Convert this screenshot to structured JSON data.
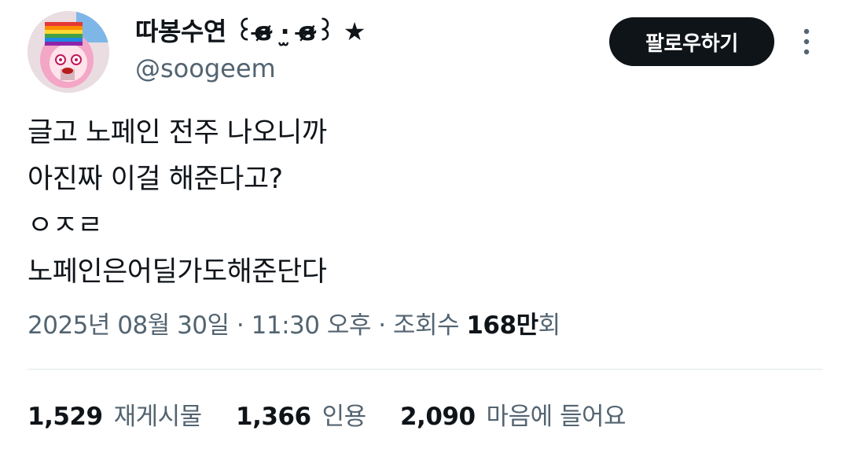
{
  "author": {
    "display_name": "따봉수연 ꒰ɞ̴̶̷ ·̫ ɞ̴̶̷꒱ ★",
    "handle": "@soogeem",
    "avatar_icon": "anime-avatar-icon"
  },
  "actions": {
    "follow_label": "팔로우하기",
    "more_icon": "more-vertical-icon"
  },
  "tweet": {
    "lines": [
      "글고 노페인 전주 나오니까",
      "아진짜 이걸 해준다고?",
      "ㅇㅈㄹ",
      "노페인은어딜가도해준단다"
    ]
  },
  "meta": {
    "date": "2025년 08월 30일",
    "sep1": " · ",
    "time": "11:30 오후",
    "sep2": " · ",
    "views_label": "조회수 ",
    "views_count": "168",
    "views_unit": "만",
    "views_suffix": "회"
  },
  "stats": {
    "reposts_count": "1,529",
    "reposts_label": "재게시물",
    "quotes_count": "1,366",
    "quotes_label": "인용",
    "likes_count": "2,090",
    "likes_label": "마음에 들어요"
  },
  "colors": {
    "text_primary": "#0f1419",
    "text_secondary": "#536471",
    "button_bg": "#0f1419",
    "divider": "#e1e8ed"
  }
}
